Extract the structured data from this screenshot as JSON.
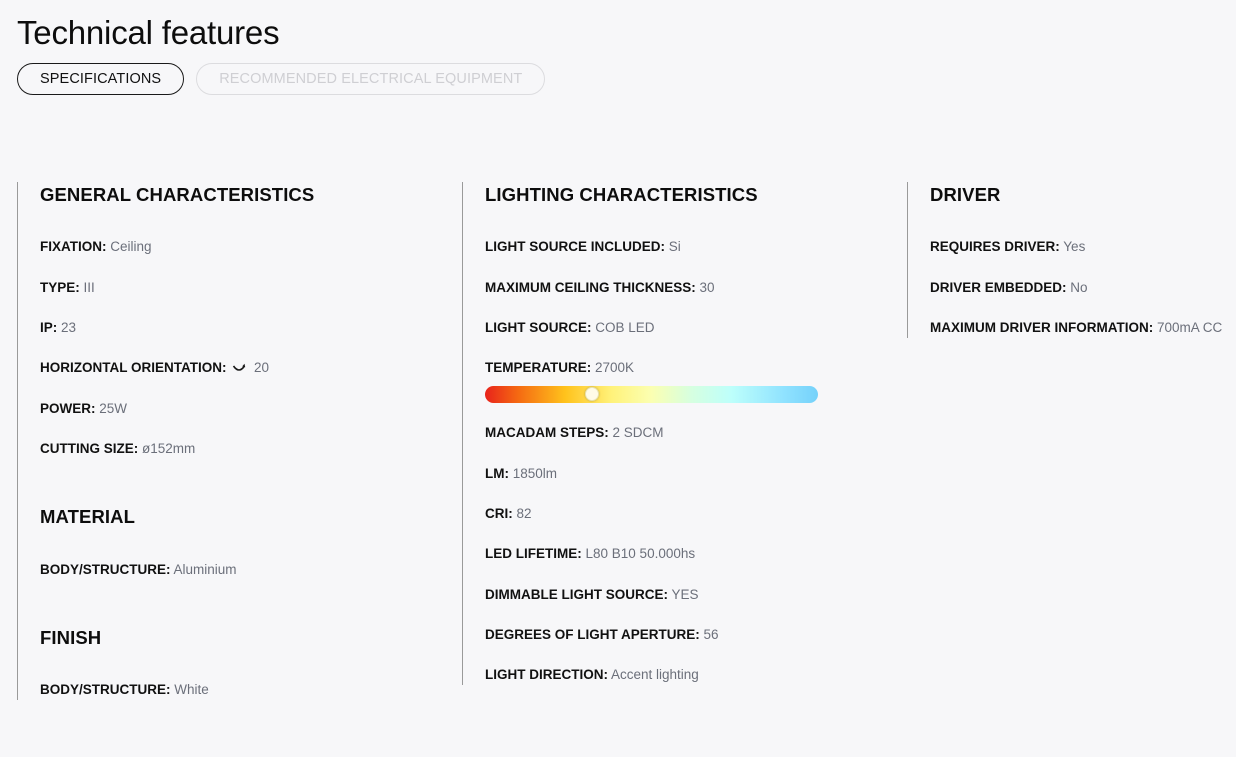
{
  "page": {
    "title": "Technical features"
  },
  "tabs": [
    {
      "label": "SPECIFICATIONS",
      "active": true
    },
    {
      "label": "RECOMMENDED ELECTRICAL EQUIPMENT",
      "active": false
    }
  ],
  "general": {
    "title": "GENERAL CHARACTERISTICS",
    "fixation": {
      "label": "FIXATION:",
      "value": "Ceiling"
    },
    "type": {
      "label": "TYPE:",
      "value": "III"
    },
    "ip": {
      "label": "IP:",
      "value": "23"
    },
    "horizontal_orientation": {
      "label": "HORIZONTAL ORIENTATION:",
      "value": "20",
      "icon": "rotate-icon"
    },
    "power": {
      "label": "POWER:",
      "value": "25W"
    },
    "cutting_size": {
      "label": "CUTTING SIZE:",
      "value": "ø152mm"
    }
  },
  "material": {
    "title": "MATERIAL",
    "body": {
      "label": "BODY/STRUCTURE:",
      "value": "Aluminium"
    }
  },
  "finish": {
    "title": "FINISH",
    "body": {
      "label": "BODY/STRUCTURE:",
      "value": "White"
    }
  },
  "lighting": {
    "title": "LIGHTING CHARACTERISTICS",
    "light_source_included": {
      "label": "LIGHT SOURCE INCLUDED:",
      "value": "Si"
    },
    "max_ceiling_thickness": {
      "label": "MAXIMUM CEILING THICKNESS:",
      "value": "30"
    },
    "light_source": {
      "label": "LIGHT SOURCE:",
      "value": "COB LED"
    },
    "temperature": {
      "label": "TEMPERATURE:",
      "value": "2700K",
      "scale_position": 0.32
    },
    "macadam_steps": {
      "label": "MACADAM STEPS:",
      "value": "2 SDCM"
    },
    "lm": {
      "label": "LM:",
      "value": "1850lm"
    },
    "cri": {
      "label": "CRI:",
      "value": "82"
    },
    "led_lifetime": {
      "label": "LED LIFETIME:",
      "value": "L80 B10 50.000hs"
    },
    "dimmable": {
      "label": "DIMMABLE LIGHT SOURCE:",
      "value": "YES"
    },
    "aperture": {
      "label": "DEGREES OF LIGHT APERTURE:",
      "value": "56"
    },
    "direction": {
      "label": "LIGHT DIRECTION:",
      "value": "Accent lighting"
    }
  },
  "driver": {
    "title": "DRIVER",
    "requires": {
      "label": "REQUIRES DRIVER:",
      "value": "Yes"
    },
    "embedded": {
      "label": "DRIVER EMBEDDED:",
      "value": "No"
    },
    "max_info": {
      "label": "MAXIMUM DRIVER INFORMATION:",
      "value": "700mA CC"
    }
  },
  "colors": {
    "background": "#f7f7f9",
    "label": "#111111",
    "value": "#6b6f7a",
    "divider": "#9a9a9a",
    "tab_inactive": "#cfcfd3"
  }
}
